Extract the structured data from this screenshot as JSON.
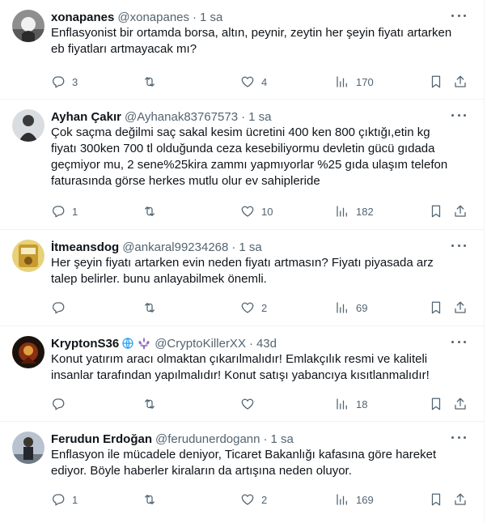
{
  "tweets": [
    {
      "name": "xonapanes",
      "handle": "@xonapanes",
      "time": "1 sa",
      "lines": [
        "Enflasyonist bir ortamda borsa, altın, peynir, zeytin her şeyin fiyatı artarken",
        "eb fiyatları artmayacak mı?"
      ],
      "replies": "3",
      "reposts": "",
      "likes": "4",
      "views": "170",
      "avatar_color": "#6b6b6b"
    },
    {
      "name": "Ayhan Çakır",
      "handle": "@Ayhanak83767573",
      "time": "1 sa",
      "lines": [
        "Çok saçma değilmi saç sakal kesim ücretini 400 ken 800 çıktığı,etin kg",
        "fiyatı 300ken 700 tl olduğunda ceza kesebiliyormu devletin gücü gıdada",
        "geçmiyor mu, 2 sene%25kira zammı yapmıyorlar %25 gıda ulaşım telefon",
        "faturasında görse herkes mutlu olur ev sahipleride"
      ],
      "replies": "1",
      "reposts": "",
      "likes": "10",
      "views": "182",
      "avatar_color": "#c9ccd0"
    },
    {
      "name": "İtmeansdog",
      "handle": "@ankaral99234268",
      "time": "1 sa",
      "lines": [
        "Her şeyin fiyatı artarken evin neden fiyatı artmasın? Fiyatı piyasada arz",
        "talep belirler. bunu anlayabilmek önemli."
      ],
      "replies": "",
      "reposts": "",
      "likes": "2",
      "views": "69",
      "avatar_color": "#d6b84a"
    },
    {
      "name": "KryptonS36",
      "handle": "@CryptoKillerXX",
      "time": "43d",
      "lines": [
        "Konut yatırım aracı olmaktan çıkarılmalıdır! Emlakçılık resmi ve kaliteli",
        "insanlar tarafından yapılmalıdır! Konut satışı yabancıya kısıtlanmalıdır!"
      ],
      "replies": "",
      "reposts": "",
      "likes": "",
      "views": "18",
      "badge_icons": [
        "globe-icon",
        "fleur-de-lis-icon"
      ],
      "avatar_color": "#2a1a12"
    },
    {
      "name": "Ferudun Erdoğan",
      "handle": "@ferudunerdogann",
      "time": "1 sa",
      "lines": [
        "Enflasyon ile mücadele deniyor, Ticaret Bakanlığı kafasına göre hareket",
        "ediyor. Böyle haberler kiraların da artışına neden oluyor."
      ],
      "replies": "1",
      "reposts": "",
      "likes": "2",
      "views": "169",
      "avatar_color": "#9aa7b5"
    }
  ]
}
